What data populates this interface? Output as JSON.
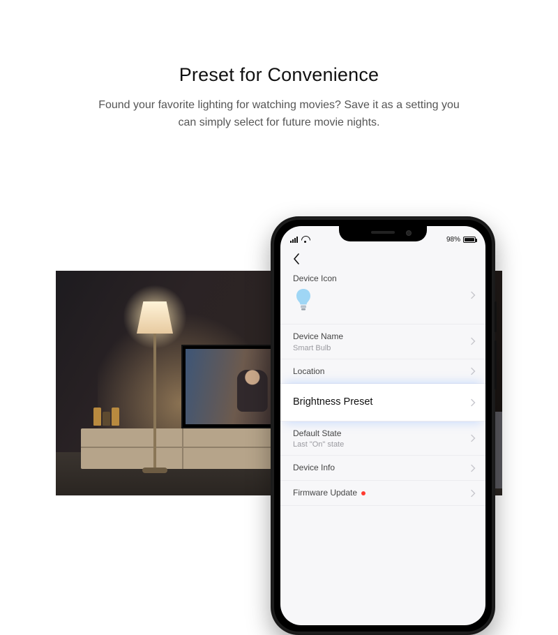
{
  "hero": {
    "title": "Preset for Convenience",
    "subtitle": "Found your favorite lighting for watching movies? Save it as a setting you can simply select for future movie nights."
  },
  "status_bar": {
    "battery_text": "98%"
  },
  "settings": {
    "device_icon": {
      "label": "Device Icon",
      "icon": "bulb-icon"
    },
    "device_name": {
      "label": "Device Name",
      "value": "Smart Bulb"
    },
    "location": {
      "label": "Location"
    },
    "brightness_preset": {
      "label": "Brightness Preset"
    },
    "default_state": {
      "label": "Default State",
      "value": "Last \"On\" state"
    },
    "device_info": {
      "label": "Device Info"
    },
    "firmware_update": {
      "label": "Firmware Update",
      "has_update": true
    }
  },
  "colors": {
    "bulb_icon": "#9fd6f5",
    "update_dot": "#ff3b30"
  }
}
